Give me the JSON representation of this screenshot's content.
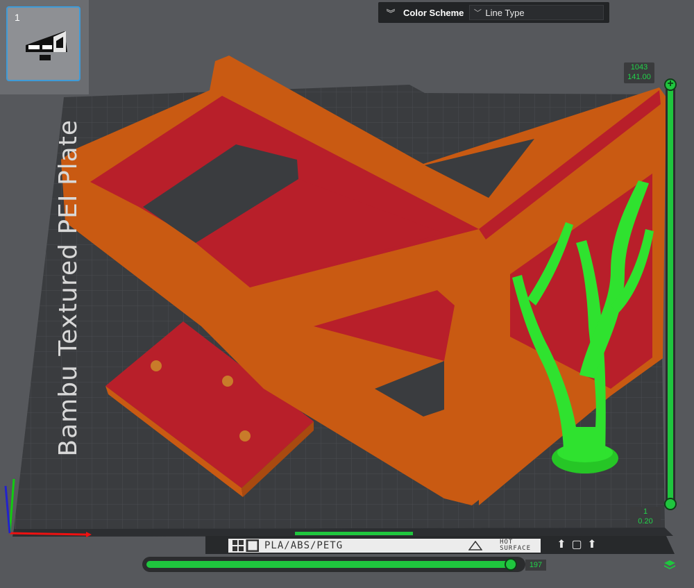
{
  "thumbnail": {
    "plate_number": "1"
  },
  "color_scheme": {
    "label": "Color Scheme",
    "selected": "Line Type",
    "collapse_icon": "double-chevron-down-icon",
    "dropdown_icon": "chevron-down-icon"
  },
  "plate": {
    "name": "Bambu Textured PEI Plate",
    "material": "PLA/ABS/PETG",
    "surface_warning_line1": "HOT",
    "surface_warning_line2": "SURFACE"
  },
  "layer_slider": {
    "top_layer": "1043",
    "top_height": "141.00",
    "bottom_layer": "1",
    "bottom_height": "0.20",
    "add_icon": "plus-icon"
  },
  "move_slider": {
    "value": "197"
  },
  "colors": {
    "model_wall": "#c95a12",
    "model_top": "#b81f2a",
    "support": "#2fe22f",
    "slider": "#1fc63e",
    "plate": "#3b3d40"
  },
  "icons": [
    "upload-icon",
    "frame-icon",
    "export-icon",
    "layers-icon"
  ]
}
